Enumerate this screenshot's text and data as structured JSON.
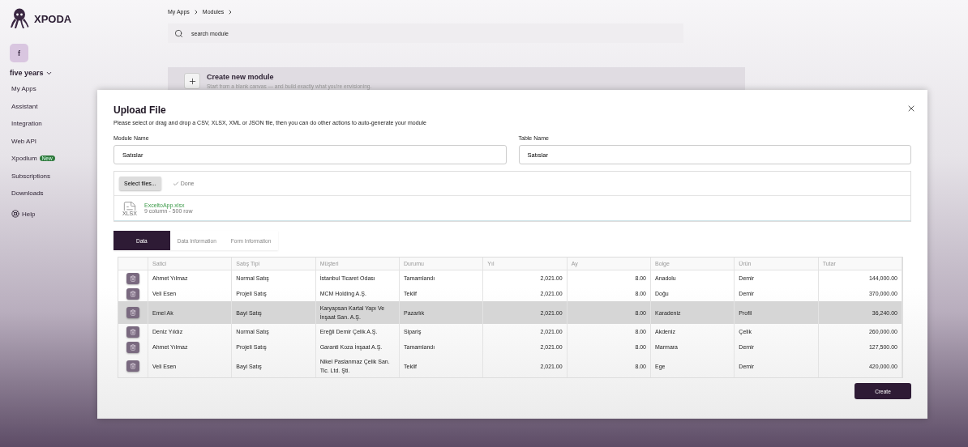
{
  "sidebar": {
    "logo": "XPODA",
    "avatar": "f",
    "workspace": "five years",
    "items": [
      {
        "label": "My Apps"
      },
      {
        "label": "Assistant"
      },
      {
        "label": "Integration"
      },
      {
        "label": "Web API"
      },
      {
        "label": "Xpodium",
        "badge": "New"
      },
      {
        "label": "Subscriptions"
      },
      {
        "label": "Downloads"
      }
    ],
    "help": "Help"
  },
  "breadcrumb": [
    "My Apps",
    "Modules"
  ],
  "search": {
    "placeholder": "search module"
  },
  "create_card": {
    "title": "Create new module",
    "subtitle": "Start from a blank canvas — and build exactly what you're envisioning."
  },
  "dialog": {
    "title": "Upload File",
    "description": "Please select or drag and drop a CSV, XLSX, XML or JSON file, then you can do other actions to auto-generate your module",
    "fields": [
      {
        "label": "Module Name",
        "value": "Satıslar"
      },
      {
        "label": "Table Name",
        "value": "Satıslar"
      }
    ],
    "upload": {
      "button": "Select files...",
      "status": "Done",
      "file": {
        "name": "ExceltoApp.xlsx",
        "type": "XLSX",
        "meta": "9 column - 500 row"
      }
    },
    "tabs": [
      {
        "label": "Data",
        "selected": true
      },
      {
        "label": "Data Information",
        "selected": false
      },
      {
        "label": "Form Information",
        "selected": false
      }
    ],
    "table": {
      "columns": [
        {
          "label": "Satici",
          "numeric": false
        },
        {
          "label": "Satış Tipi",
          "numeric": false
        },
        {
          "label": "Müşteri",
          "numeric": false
        },
        {
          "label": "Durumu",
          "numeric": false
        },
        {
          "label": "Yıl",
          "numeric": true
        },
        {
          "label": "Ay",
          "numeric": true
        },
        {
          "label": "Bolge",
          "numeric": false
        },
        {
          "label": "Ürün",
          "numeric": false
        },
        {
          "label": "Tutar",
          "numeric": true
        }
      ],
      "rows": [
        {
          "selected": false,
          "cells": [
            "Ahmet Yılmaz",
            "Normal Satış",
            "İstanbul Ticaret Odası",
            "Tamamlandı",
            "2,021.00",
            "8.00",
            "Anadolu",
            "Demir",
            "144,000.00"
          ]
        },
        {
          "selected": false,
          "cells": [
            "Veli Esen",
            "Projeli Satış",
            "MCM Holding A.Ş.",
            "Teklif",
            "2,021.00",
            "8.00",
            "Doğu",
            "Demir",
            "370,000.00"
          ]
        },
        {
          "selected": true,
          "cells": [
            "Emel Ak",
            "Bayi Satış",
            "Karyapsan Kartal Yapı Ve İnşaat San. A.Ş.",
            "Pazarlık",
            "2,021.00",
            "8.00",
            "Karadeniz",
            "Profil",
            "36,240.00"
          ]
        },
        {
          "selected": false,
          "cells": [
            "Deniz Yıldız",
            "Normal Satış",
            "Ereğli Demir Çelik A.Ş.",
            "Sipariş",
            "2,021.00",
            "8.00",
            "Akdeniz",
            "Çelik",
            "260,000.00"
          ]
        },
        {
          "selected": false,
          "cells": [
            "Ahmet Yılmaz",
            "Projeli Satış",
            "Garanti Koza İnşaat A.Ş.",
            "Tamamlandı",
            "2,021.00",
            "8.00",
            "Marmara",
            "Demir",
            "127,500.00"
          ]
        },
        {
          "selected": false,
          "cells": [
            "Veli Esen",
            "Bayi Satış",
            "Nikel Paslanmaz Çelik San. Tic. Ltd. Şti.",
            "Teklif",
            "2,021.00",
            "8.00",
            "Ege",
            "Demir",
            "420,000.00"
          ]
        }
      ]
    },
    "create_button": "Create"
  }
}
